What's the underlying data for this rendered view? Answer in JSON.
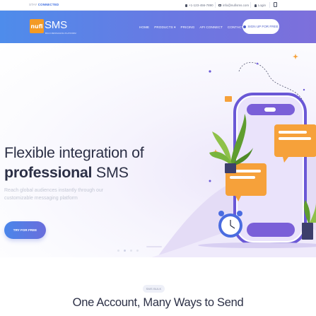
{
  "topbar": {
    "stay_prefix": "STAY",
    "stay_status": "CONNECTED",
    "phone": "+1-123-456-7890",
    "email": "info@nufisms.com",
    "login": "Login"
  },
  "brand": {
    "mark": "nufi",
    "name": "SMS",
    "tagline": "BULK MESSAGING PLATFORM",
    "accent": "#f39a25"
  },
  "nav": {
    "items": [
      {
        "label": "HOME"
      },
      {
        "label": "PRODUCTS ▾"
      },
      {
        "label": "PRICING"
      },
      {
        "label": "API CONNECT"
      },
      {
        "label": "CONTACT US"
      }
    ],
    "signup_label": "SIGN UP FOR FREE",
    "gradient_start": "#4e8ceb",
    "gradient_end": "#7d6fdb"
  },
  "hero": {
    "title_line1": "Flexible integration of",
    "title_bold": "professional",
    "title_rest": " SMS",
    "subtitle": "Reach global audiences instantly through our customizable messaging platform",
    "cta_label": "TRY FOR FREE",
    "slide_count": 4,
    "active_slide": 2
  },
  "section": {
    "badge": "SMS BULK",
    "title": "One Account, Many Ways to Send"
  }
}
